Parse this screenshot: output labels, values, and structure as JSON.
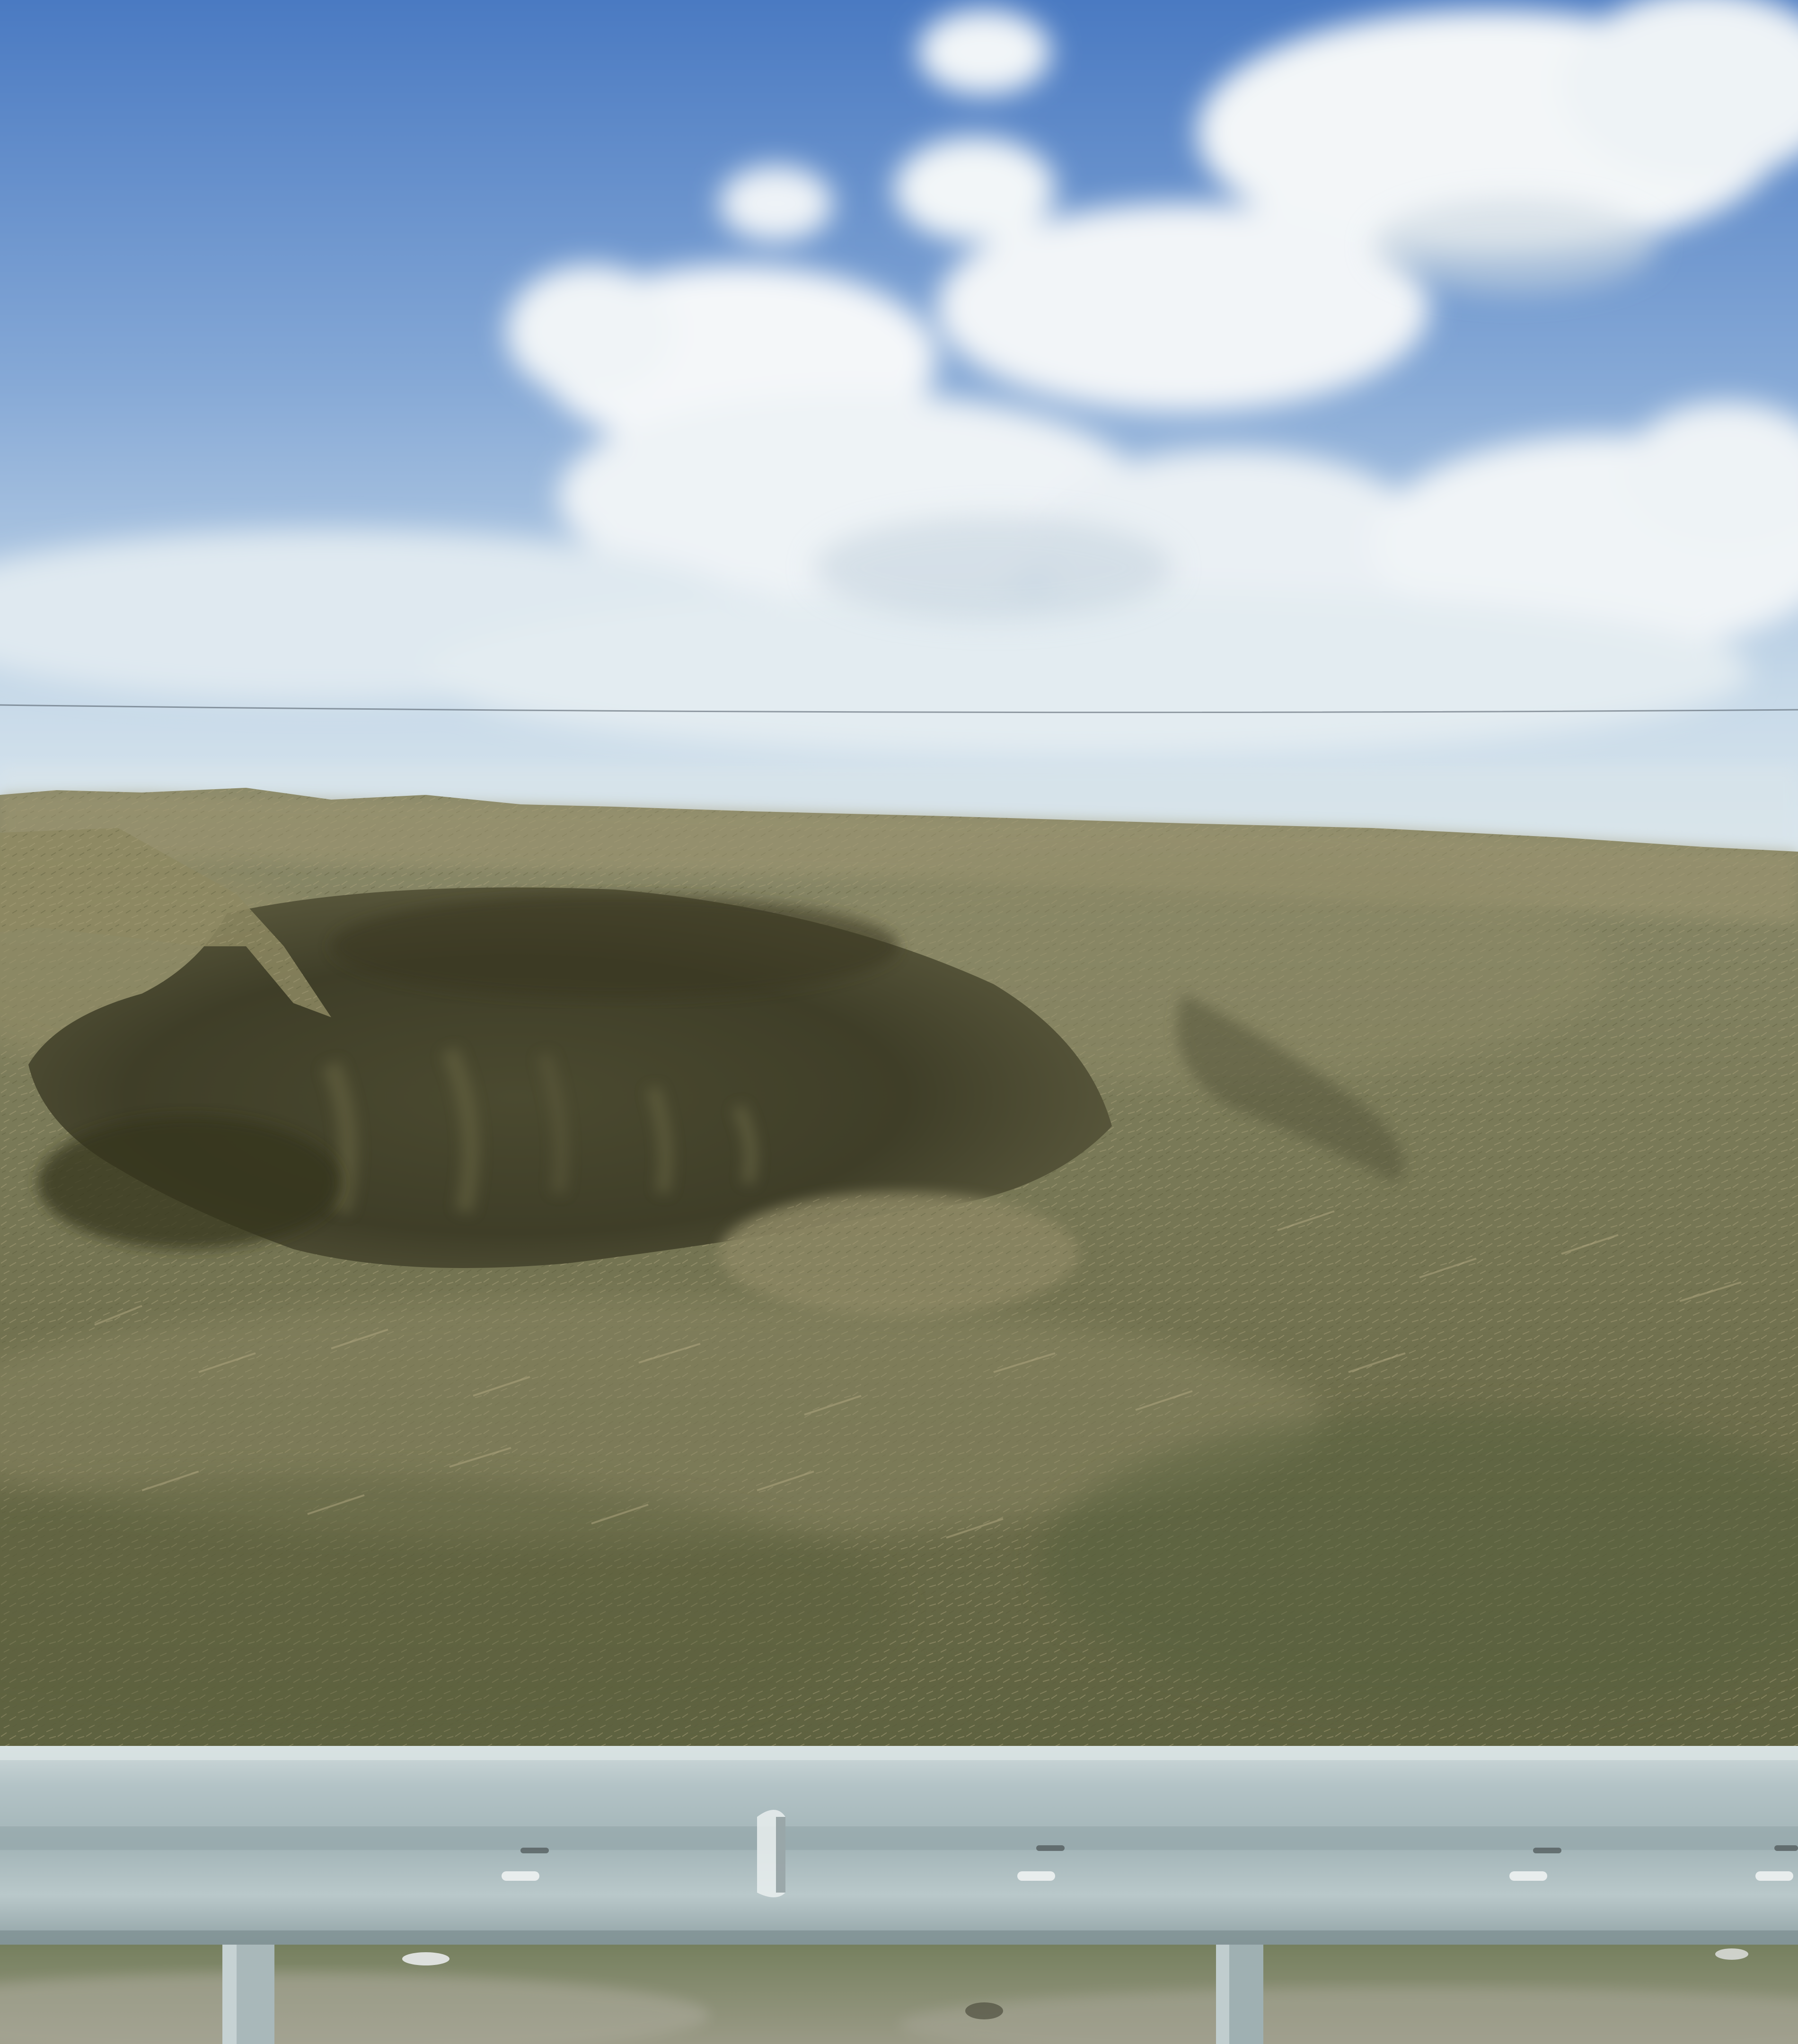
{
  "scene": {
    "description_alt": "",
    "colors": {
      "sky_top": "#4f7fc4",
      "sky_mid": "#8fb1d9",
      "sky_horizon": "#d9e6ee",
      "cloud": "#f4f7f9",
      "cloud_shadow": "#c9d6e0",
      "hill_light": "#8a8868",
      "hill_mid": "#6e6e4c",
      "hill_dark": "#4a4a30",
      "cave_shadow": "#3a3a26",
      "cave_inner": "#555238",
      "grass_dry": "#a89f78",
      "guardrail_light": "#c3cfd1",
      "guardrail_mid": "#9eb0b3",
      "guardrail_dark": "#7e9094",
      "ground": "#8a8a76",
      "ground_grass": "#6f7a55"
    }
  }
}
